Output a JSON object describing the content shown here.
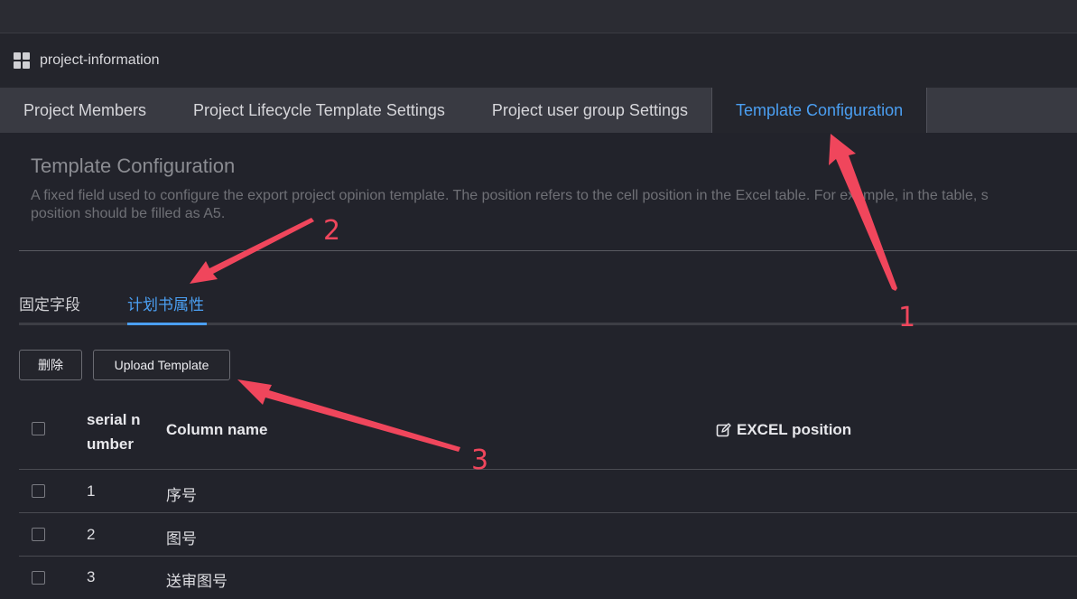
{
  "window": {
    "title": "project-information"
  },
  "tabs": [
    {
      "label": "Project Members"
    },
    {
      "label": "Project Lifecycle Template Settings"
    },
    {
      "label": "Project user group Settings"
    },
    {
      "label": "Template Configuration",
      "active": true
    }
  ],
  "section": {
    "title": "Template Configuration",
    "description_line1": "A fixed field used to configure the export project opinion template. The position refers to the cell position in the Excel table. For example, in the table, s",
    "description_line2": "position should be filled as A5."
  },
  "subtabs": [
    {
      "label": "固定字段"
    },
    {
      "label": "计划书属性",
      "active": true
    }
  ],
  "toolbar": {
    "delete_label": "删除",
    "upload_label": "Upload Template"
  },
  "table": {
    "headers": {
      "serial_line1": "serial n",
      "serial_line2": "umber",
      "column_name": "Column name",
      "excel_position": "EXCEL position"
    },
    "rows": [
      {
        "serial": "1",
        "name": "序号"
      },
      {
        "serial": "2",
        "name": "图号"
      },
      {
        "serial": "3",
        "name": "送审图号"
      }
    ]
  },
  "annotations": {
    "marker_1": "1",
    "marker_2": "2",
    "marker_3": "3",
    "color": "#f0465c"
  },
  "colors": {
    "accent": "#4b9ff2",
    "background": "#22232b",
    "tabbar": "#393a42"
  }
}
